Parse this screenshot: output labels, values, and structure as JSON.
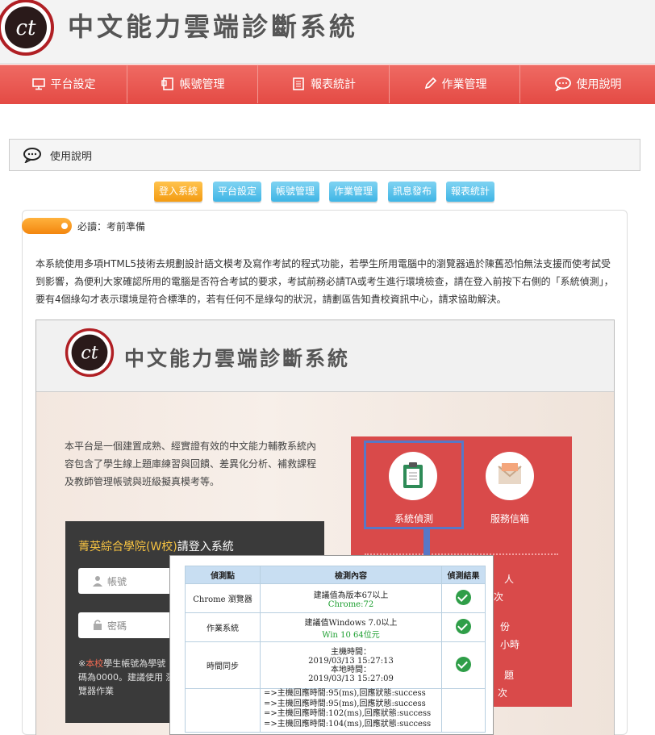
{
  "site": {
    "title": "中文能力雲端診斷系統"
  },
  "nav": [
    {
      "label": "平台設定",
      "icon": "monitor-icon"
    },
    {
      "label": "帳號管理",
      "icon": "document-icon"
    },
    {
      "label": "報表統計",
      "icon": "list-icon"
    },
    {
      "label": "作業管理",
      "icon": "pencil-icon"
    },
    {
      "label": "使用說明",
      "icon": "chat-icon"
    }
  ],
  "breadcrumb": {
    "label": "使用說明",
    "icon": "chat-icon"
  },
  "tabs": [
    {
      "label": "登入系統",
      "style": "orange"
    },
    {
      "label": "平台設定",
      "style": "blue"
    },
    {
      "label": "帳號管理",
      "style": "blue"
    },
    {
      "label": "作業管理",
      "style": "blue"
    },
    {
      "label": "訊息發布",
      "style": "blue"
    },
    {
      "label": "報表統計",
      "style": "blue"
    }
  ],
  "notice": {
    "label": "必讀：考前準備",
    "paragraph": "本系統使用多項HTML5技術去規劃設計語文模考及寫作考試的程式功能，若學生所用電腦中的瀏覽器過於陳舊恐怕無法支援而使考試受到影響，為便利大家確認所用的電腦是否符合考試的要求，考試前務必請TA或考生進行環境檢查，請在登入前按下右側的「系統偵測」，要有4個綠勾才表示環境是符合標準的，若有任何不是綠勾的狀況，請劃區告知貴校資訊中心，請求協助解決。"
  },
  "screenshot": {
    "title": "中文能力雲端診斷系統",
    "intro": "本平台是一個建置成熟、經實證有效的中文能力輔教系統內容包含了學生線上題庫練習與回饋、差異化分析、補救課程及教師管理帳號與班級擬真模考等。",
    "login": {
      "school": "菁英綜合學院(W校)",
      "title_suffix": "請登入系統",
      "account_placeholder": "帳號",
      "password_placeholder": "密碼",
      "note_prefix": "※",
      "note_red": "本校",
      "note_rest": "學生帳號為學號 碼為0000。建議使用 瀏覽器作業"
    },
    "panel": {
      "items": [
        {
          "label": "系統偵測"
        },
        {
          "label": "服務信箱"
        }
      ],
      "partial": [
        "人",
        "次",
        "份",
        "小時",
        "題",
        "次"
      ]
    },
    "check_table": {
      "headers": [
        "偵測點",
        "檢測內容",
        "偵測結果"
      ],
      "rows": [
        {
          "point": "Chrome 瀏覽器",
          "content": "建議值為版本67以上",
          "detail": "Chrome:72",
          "ok": true
        },
        {
          "point": "作業系統",
          "content": "建議值Windows 7.0以上",
          "detail": "Win 10 64位元",
          "ok": true
        },
        {
          "point": "時間同步",
          "content": "主機時間：",
          "detail": "2019/03/13 15:27:13",
          "content2": "本地時間：",
          "detail2": "2019/03/13 15:27:09",
          "ok": true
        }
      ],
      "log": [
        "=>主機回應時間:95(ms),回應狀態:success",
        "=>主機回應時間:95(ms),回應狀態:success",
        "=>主機回應時間:102(ms),回應狀態:success",
        "=>主機回應時間:104(ms),回應狀態:success"
      ]
    }
  }
}
